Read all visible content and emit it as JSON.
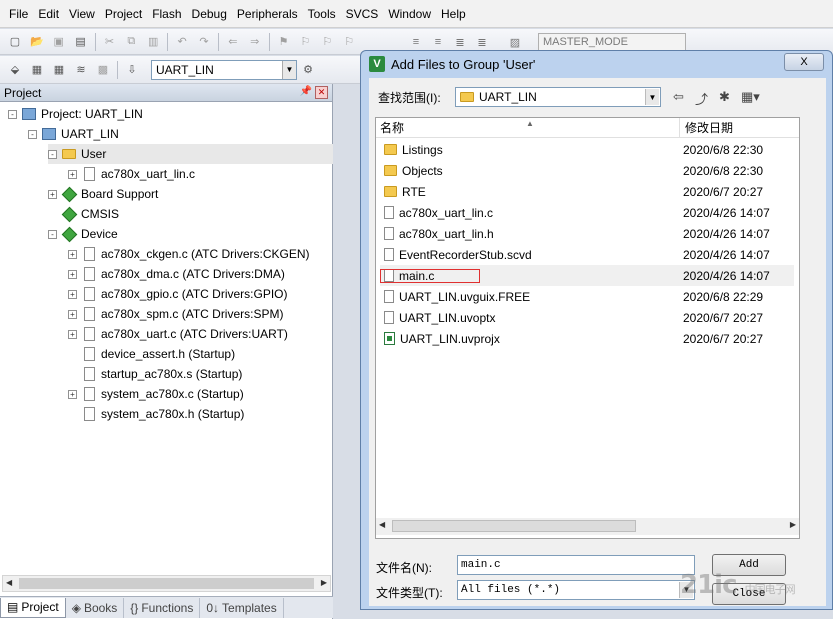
{
  "menu": [
    "File",
    "Edit",
    "View",
    "Project",
    "Flash",
    "Debug",
    "Peripherals",
    "Tools",
    "SVCS",
    "Window",
    "Help"
  ],
  "toolbar": {
    "target": "UART_LIN",
    "mode": "MASTER_MODE"
  },
  "project_pane": {
    "title": "Project",
    "tree": [
      {
        "label": "Project: UART_LIN",
        "indent": 0,
        "expander": "-",
        "icon": "project"
      },
      {
        "label": "UART_LIN",
        "indent": 1,
        "expander": "-",
        "icon": "target"
      },
      {
        "label": "User",
        "indent": 2,
        "expander": "-",
        "icon": "folder"
      },
      {
        "label": "ac780x_uart_lin.c",
        "indent": 3,
        "expander": "+",
        "icon": "file"
      },
      {
        "label": "Board Support",
        "indent": 2,
        "expander": "+",
        "icon": "group"
      },
      {
        "label": "CMSIS",
        "indent": 2,
        "expander": "",
        "icon": "group"
      },
      {
        "label": "Device",
        "indent": 2,
        "expander": "-",
        "icon": "group"
      },
      {
        "label": "ac780x_ckgen.c (ATC Drivers:CKGEN)",
        "indent": 3,
        "expander": "+",
        "icon": "file"
      },
      {
        "label": "ac780x_dma.c (ATC Drivers:DMA)",
        "indent": 3,
        "expander": "+",
        "icon": "file"
      },
      {
        "label": "ac780x_gpio.c (ATC Drivers:GPIO)",
        "indent": 3,
        "expander": "+",
        "icon": "file"
      },
      {
        "label": "ac780x_spm.c (ATC Drivers:SPM)",
        "indent": 3,
        "expander": "+",
        "icon": "file"
      },
      {
        "label": "ac780x_uart.c (ATC Drivers:UART)",
        "indent": 3,
        "expander": "+",
        "icon": "file"
      },
      {
        "label": "device_assert.h (Startup)",
        "indent": 3,
        "expander": "",
        "icon": "file"
      },
      {
        "label": "startup_ac780x.s (Startup)",
        "indent": 3,
        "expander": "",
        "icon": "file"
      },
      {
        "label": "system_ac780x.c (Startup)",
        "indent": 3,
        "expander": "+",
        "icon": "file"
      },
      {
        "label": "system_ac780x.h (Startup)",
        "indent": 3,
        "expander": "",
        "icon": "file"
      }
    ],
    "tabs": [
      "Project",
      "Books",
      "Functions",
      "Templates"
    ]
  },
  "dialog": {
    "title": "Add Files to Group 'User'",
    "close": "X",
    "look_in_label": "查找范围(I):",
    "look_in_value": "UART_LIN",
    "col_name": "名称",
    "col_date": "修改日期",
    "files": [
      {
        "name": "Listings",
        "date": "2020/6/8 22:30",
        "type": "folder"
      },
      {
        "name": "Objects",
        "date": "2020/6/8 22:30",
        "type": "folder"
      },
      {
        "name": "RTE",
        "date": "2020/6/7 20:27",
        "type": "folder"
      },
      {
        "name": "ac780x_uart_lin.c",
        "date": "2020/4/26 14:07",
        "type": "file"
      },
      {
        "name": "ac780x_uart_lin.h",
        "date": "2020/4/26 14:07",
        "type": "file"
      },
      {
        "name": "EventRecorderStub.scvd",
        "date": "2020/4/26 14:07",
        "type": "file"
      },
      {
        "name": "main.c",
        "date": "2020/4/26 14:07",
        "type": "file",
        "highlighted": true
      },
      {
        "name": "UART_LIN.uvguix.FREE",
        "date": "2020/6/8 22:29",
        "type": "file"
      },
      {
        "name": "UART_LIN.uvoptx",
        "date": "2020/6/7 20:27",
        "type": "file"
      },
      {
        "name": "UART_LIN.uvprojx",
        "date": "2020/6/7 20:27",
        "type": "project"
      }
    ],
    "filename_label": "文件名(N):",
    "filename_value": "main.c",
    "filetype_label": "文件类型(T):",
    "filetype_value": "All files (*.*)",
    "add_label": "Add",
    "close_label": "Close"
  },
  "watermark": {
    "main": "21ic",
    "sub": "中国电子网"
  }
}
